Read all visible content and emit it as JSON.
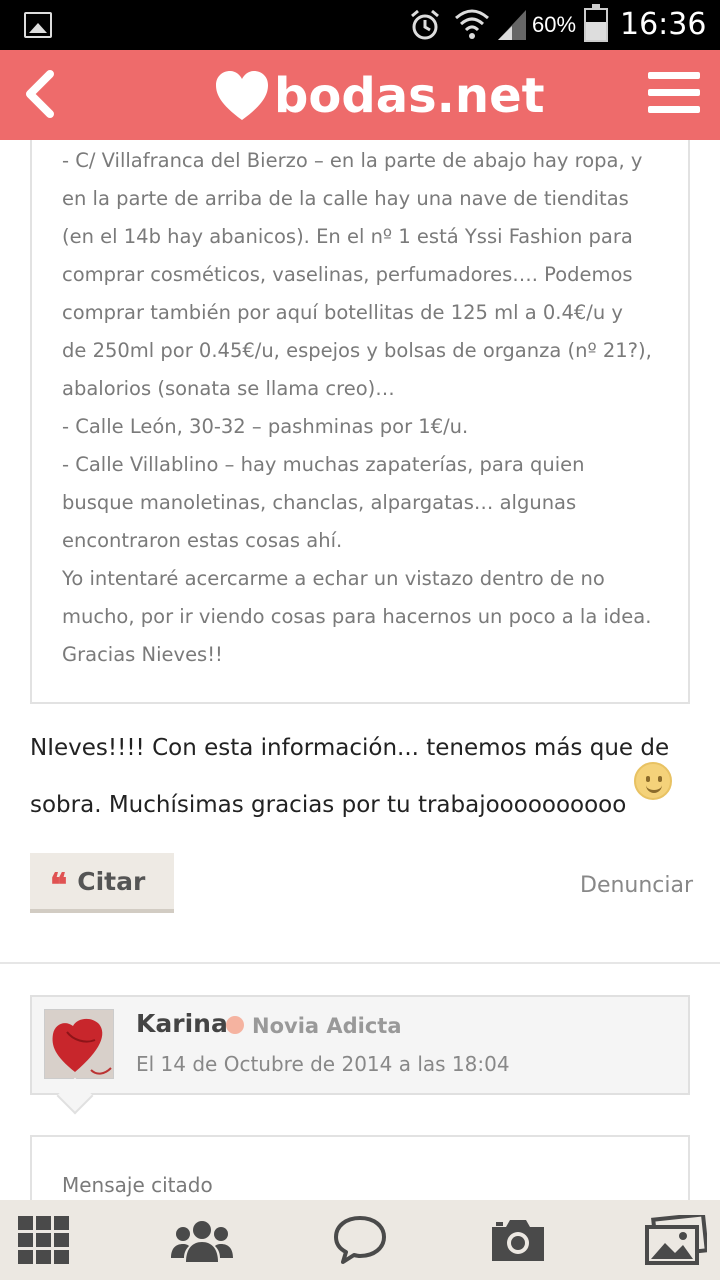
{
  "status_bar": {
    "battery_percent": "60%",
    "time": "16:36"
  },
  "header": {
    "logo_text": "bodas.net",
    "colors": {
      "brand": "#ee6b6b"
    }
  },
  "quoted_message": {
    "lines": [
      "- C/ Villafranca del Bierzo – en la parte de abajo hay ropa, y",
      "en la parte de arriba de la calle hay una nave de tienditas",
      "(en el 14b hay abanicos). En el nº 1 está Yssi Fashion para",
      "comprar cosméticos, vaselinas, perfumadores…. Podemos",
      "comprar también por aquí botellitas de 125 ml a 0.4€/u y",
      "de 250ml por 0.45€/u, espejos y bolsas de organza (nº 21?),",
      "abalorios (sonata se llama creo)…",
      "- Calle León, 30-32 – pashminas por 1€/u.",
      "- Calle Villablino – hay muchas zapaterías, para quien",
      "busque manoletinas, chanclas, alpargatas… algunas",
      "encontraron estas cosas ahí.",
      "Yo intentaré acercarme a echar un vistazo dentro de no",
      "mucho, por ir viendo cosas para hacernos un poco a la idea.",
      "Gracias Nieves!!"
    ]
  },
  "post": {
    "line1": "NIeves!!!! Con esta información... tenemos más que de",
    "line2": "sobra. Muchísimas gracias por tu trabajoooooooooo",
    "quote_button": "Citar",
    "report_link": "Denunciar"
  },
  "next_post": {
    "author": "Karina",
    "role": "Novia Adicta",
    "date": "El 14 de Octubre de 2014 a las 18:04",
    "quoted_label": "Mensaje citado"
  }
}
